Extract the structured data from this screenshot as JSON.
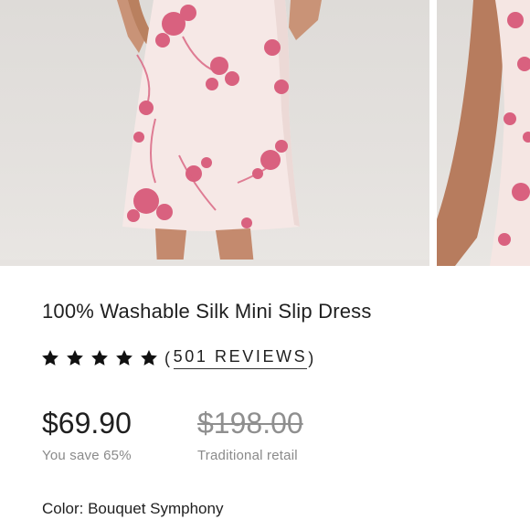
{
  "gallery": {
    "images": [
      {
        "alt": "Model wearing pink floral silk mini slip dress",
        "active": true
      },
      {
        "alt": "Side view of dress",
        "active": false
      }
    ]
  },
  "product": {
    "title": "100% Washable Silk Mini Slip Dress",
    "rating_value": 5,
    "rating_max": 5,
    "reviews_open": "(",
    "reviews_text": "501 REVIEWS",
    "reviews_close": ")",
    "sale_price": "$69.90",
    "savings": "You save 65%",
    "retail_price": "$198.00",
    "retail_label": "Traditional retail",
    "color_label": "Color:",
    "color_value": "Bouquet Symphony"
  },
  "colors": {
    "text": "#1f1f1f",
    "muted": "#8a8a8a",
    "star": "#111111",
    "dress_base": "#f7e9e7",
    "floral": "#d9617f"
  }
}
